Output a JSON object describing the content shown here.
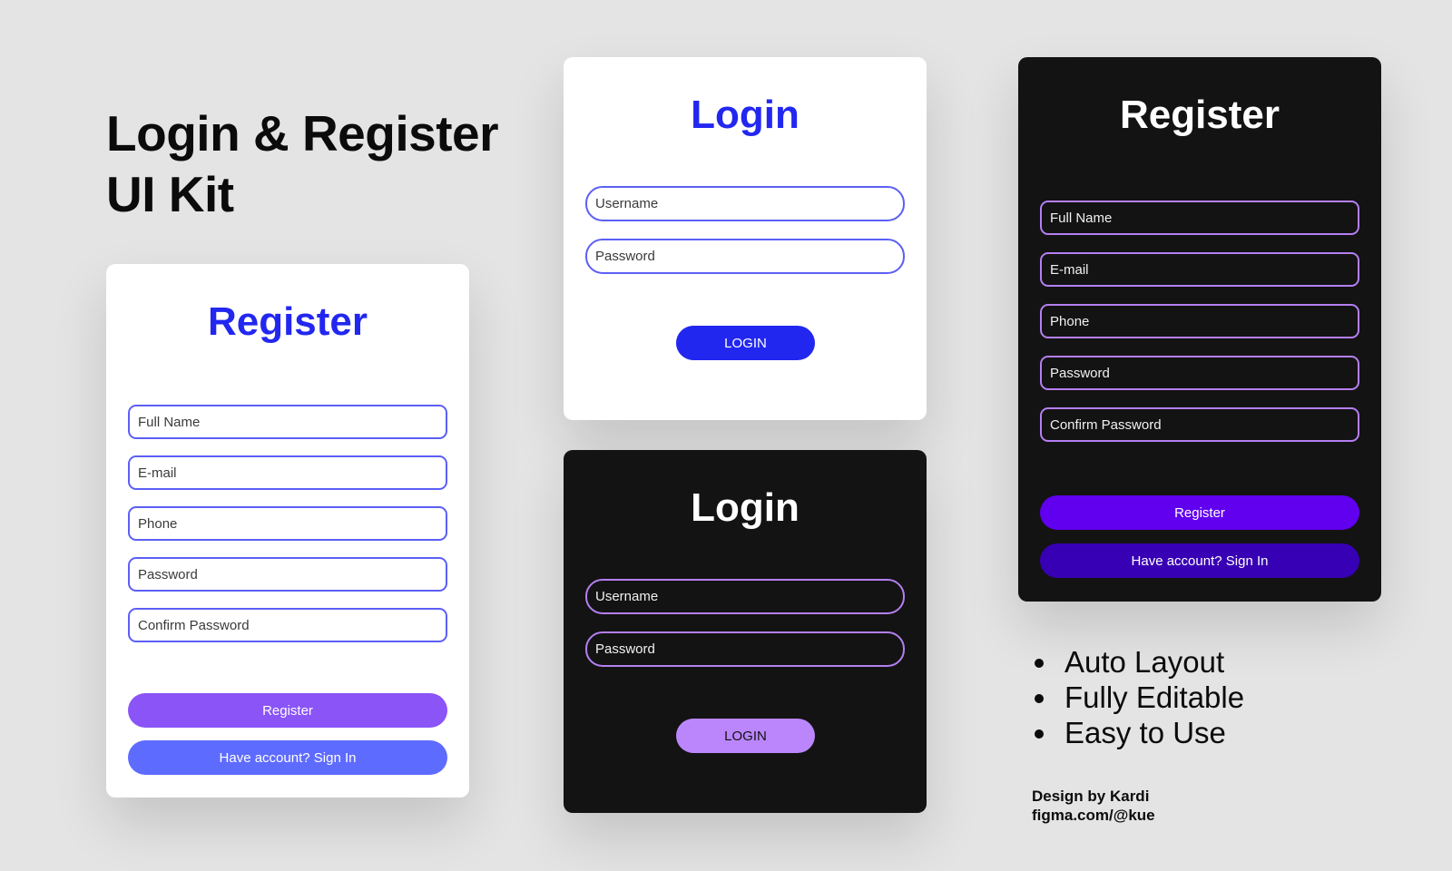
{
  "hero": {
    "line1": "Login & Register",
    "line2": "UI Kit"
  },
  "register_light": {
    "title": "Register",
    "fields": {
      "full_name": "Full Name",
      "email": "E-mail",
      "phone": "Phone",
      "password": "Password",
      "confirm_password": "Confirm Password"
    },
    "register_label": "Register",
    "signin_label": "Have account? Sign In"
  },
  "login_light": {
    "title": "Login",
    "username_placeholder": "Username",
    "password_placeholder": "Password",
    "button_label": "LOGIN"
  },
  "login_dark": {
    "title": "Login",
    "username_placeholder": "Username",
    "password_placeholder": "Password",
    "button_label": "LOGIN"
  },
  "register_dark": {
    "title": "Register",
    "fields": {
      "full_name": "Full Name",
      "email": "E-mail",
      "phone": "Phone",
      "password": "Password",
      "confirm_password": "Confirm Password"
    },
    "register_label": "Register",
    "signin_label": "Have account? Sign In"
  },
  "features": [
    "Auto Layout",
    "Fully Editable",
    "Easy to Use"
  ],
  "credit": {
    "line1": "Design by Kardi",
    "line2": "figma.com/@kue"
  },
  "colors": {
    "background": "#e4e4e4",
    "light_title": "#2227f0",
    "light_field_border": "#5c5ff5",
    "dark_card": "#131313",
    "dark_field_border": "#b47ff2",
    "light_login_button": "#2227f0",
    "dark_login_button": "#bb86fc",
    "light_register_button": "#8a54f7",
    "light_signin_button": "#5e6bff",
    "dark_register_button": "#6100ee",
    "dark_signin_button": "#3800b4"
  }
}
